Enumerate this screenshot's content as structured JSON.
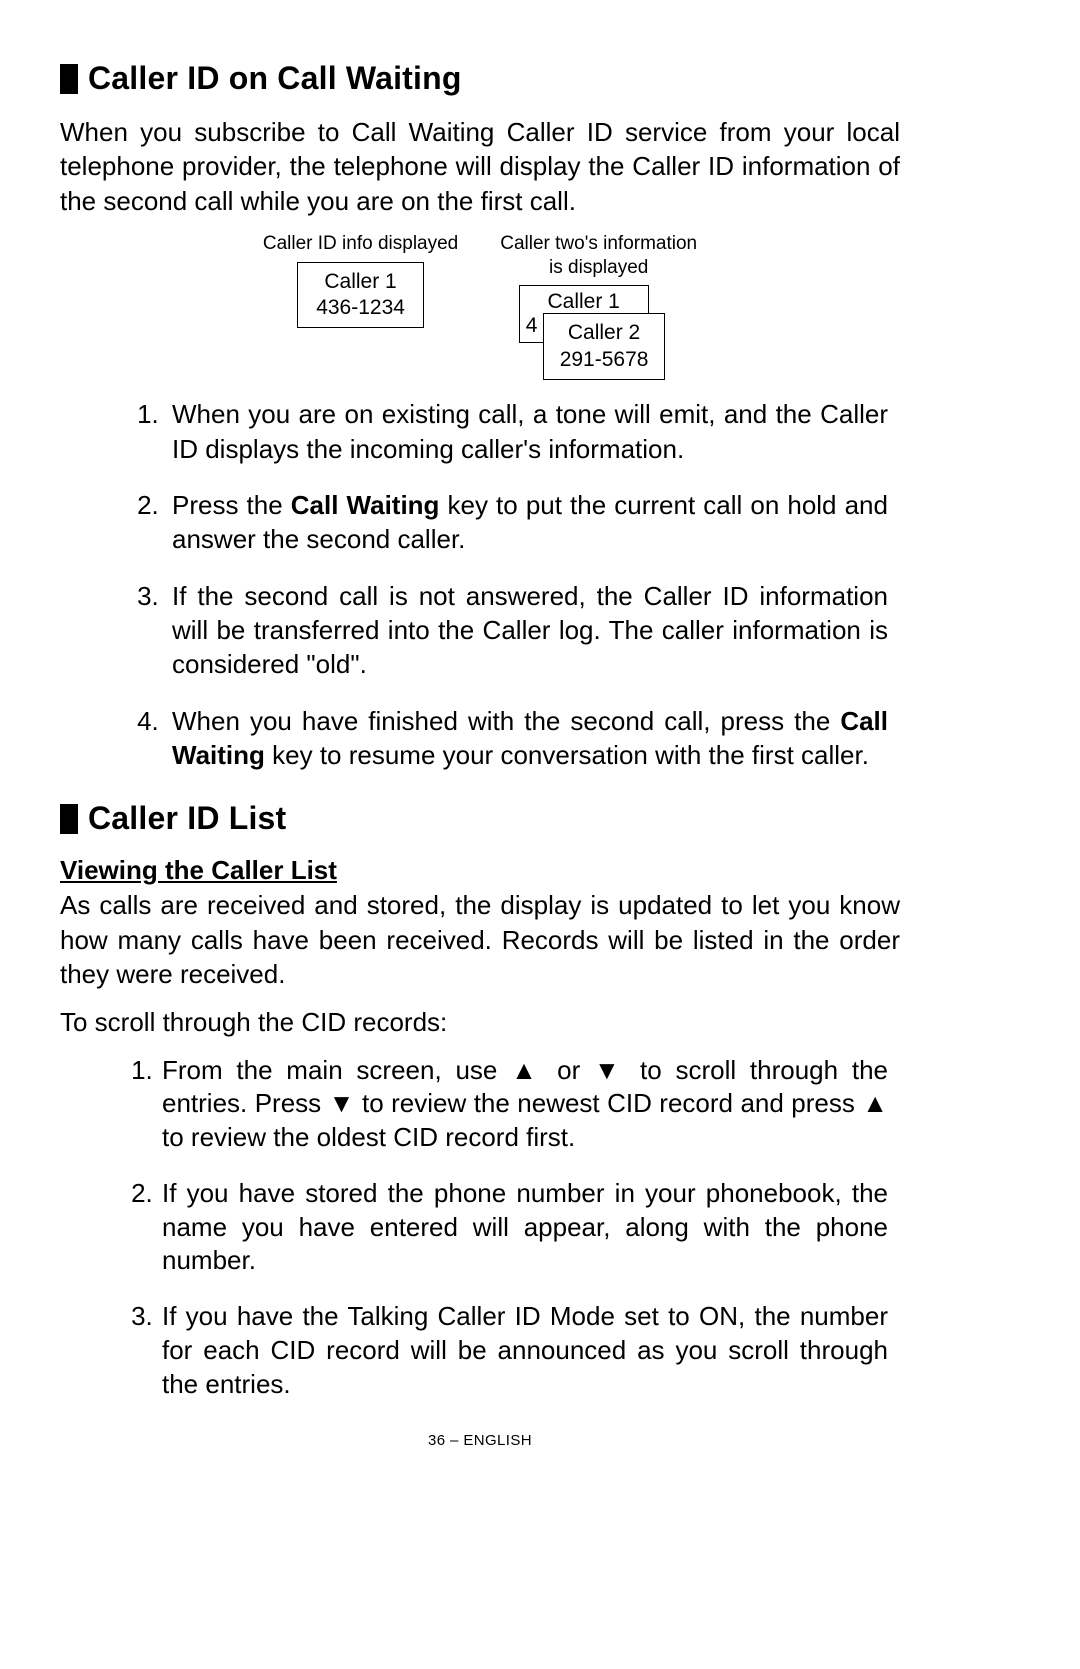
{
  "section1": {
    "title": "Caller ID on Call Waiting",
    "intro": "When you subscribe to Call Waiting Caller ID service from your local telephone provider, the telephone will display the Caller ID information of the second call while you are on the first call.",
    "fig1": {
      "caption": "Caller ID info displayed",
      "line1": "Caller  1",
      "line2": "436-1234"
    },
    "fig2": {
      "caption1": "Caller two's information",
      "caption2": "is displayed",
      "back_line1": "Caller  1",
      "back_line2": "4",
      "front_line1": "Caller  2",
      "front_line2": "291-5678"
    },
    "steps": {
      "s1": "When you are on existing call, a tone will emit, and the Caller ID displays the incoming caller's information.",
      "s2a": "Press the ",
      "s2b": "Call Waiting",
      "s2c": " key to put the current call on hold and answer the second caller.",
      "s3": "If the second call is not answered, the Caller ID information will be transferred into the Caller log. The caller information is considered \"old\".",
      "s4a": "When you have finished with the second call, press the ",
      "s4b": "Call Waiting",
      "s4c": " key to resume your conversation with the first caller."
    }
  },
  "section2": {
    "title": "Caller ID List",
    "subhead": "Viewing the Caller List",
    "p1": "As calls are received and stored, the display is updated to let you know how many calls have been received. Records will be listed in the order they were received.",
    "p2": "To scroll through the CID records:",
    "steps": {
      "s1a": "From the main screen, use ",
      "up": "▲",
      "s1b": " or ",
      "down": "▼",
      "s1c": " to scroll through the entries.  Press ",
      "s1d": " to review the newest CID record and press ",
      "s1e": " to review the oldest CID record first.",
      "s2": "If you have stored the phone number in your phonebook, the name you have entered will appear, along with the phone number.",
      "s3": "If you have the Talking Caller ID Mode set to ON, the number for each CID record will be announced as you scroll through the entries."
    }
  },
  "footer": "36 – ENGLISH"
}
